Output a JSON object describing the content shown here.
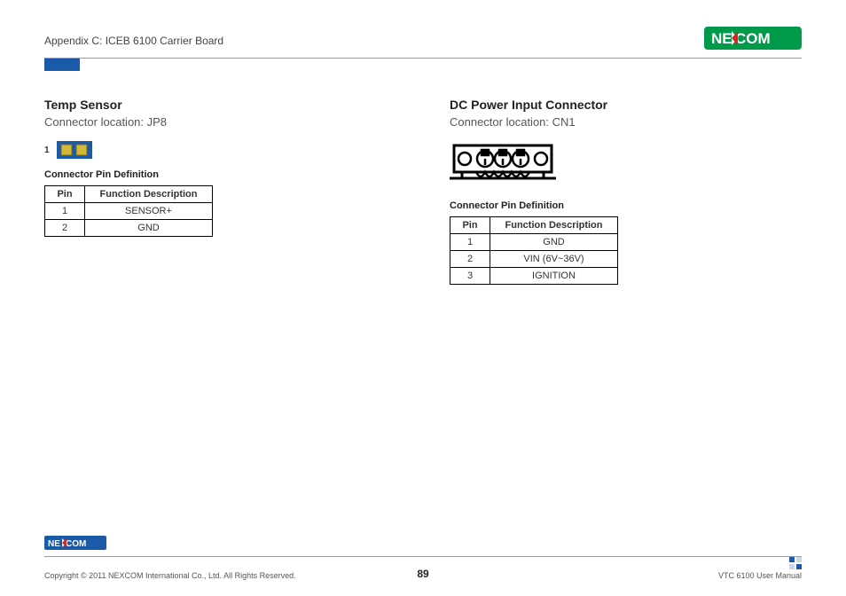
{
  "header": {
    "appendix": "Appendix C: ICEB 6100 Carrier Board",
    "brand": "NEXCOM"
  },
  "left": {
    "title": "Temp Sensor",
    "location": "Connector location: JP8",
    "pin_marker": "1",
    "table_caption": "Connector Pin Definition",
    "headers": {
      "pin": "Pin",
      "func": "Function Description"
    },
    "rows": [
      {
        "pin": "1",
        "func": "SENSOR+"
      },
      {
        "pin": "2",
        "func": "GND"
      }
    ]
  },
  "right": {
    "title": "DC Power Input Connector",
    "location": "Connector location: CN1",
    "table_caption": "Connector Pin Definition",
    "headers": {
      "pin": "Pin",
      "func": "Function Description"
    },
    "rows": [
      {
        "pin": "1",
        "func": "GND"
      },
      {
        "pin": "2",
        "func": "VIN (6V~36V)"
      },
      {
        "pin": "3",
        "func": "IGNITION"
      }
    ]
  },
  "footer": {
    "copyright": "Copyright © 2011 NEXCOM International Co., Ltd. All Rights Reserved.",
    "page": "89",
    "manual": "VTC 6100 User Manual",
    "brand": "NEXCOM"
  }
}
